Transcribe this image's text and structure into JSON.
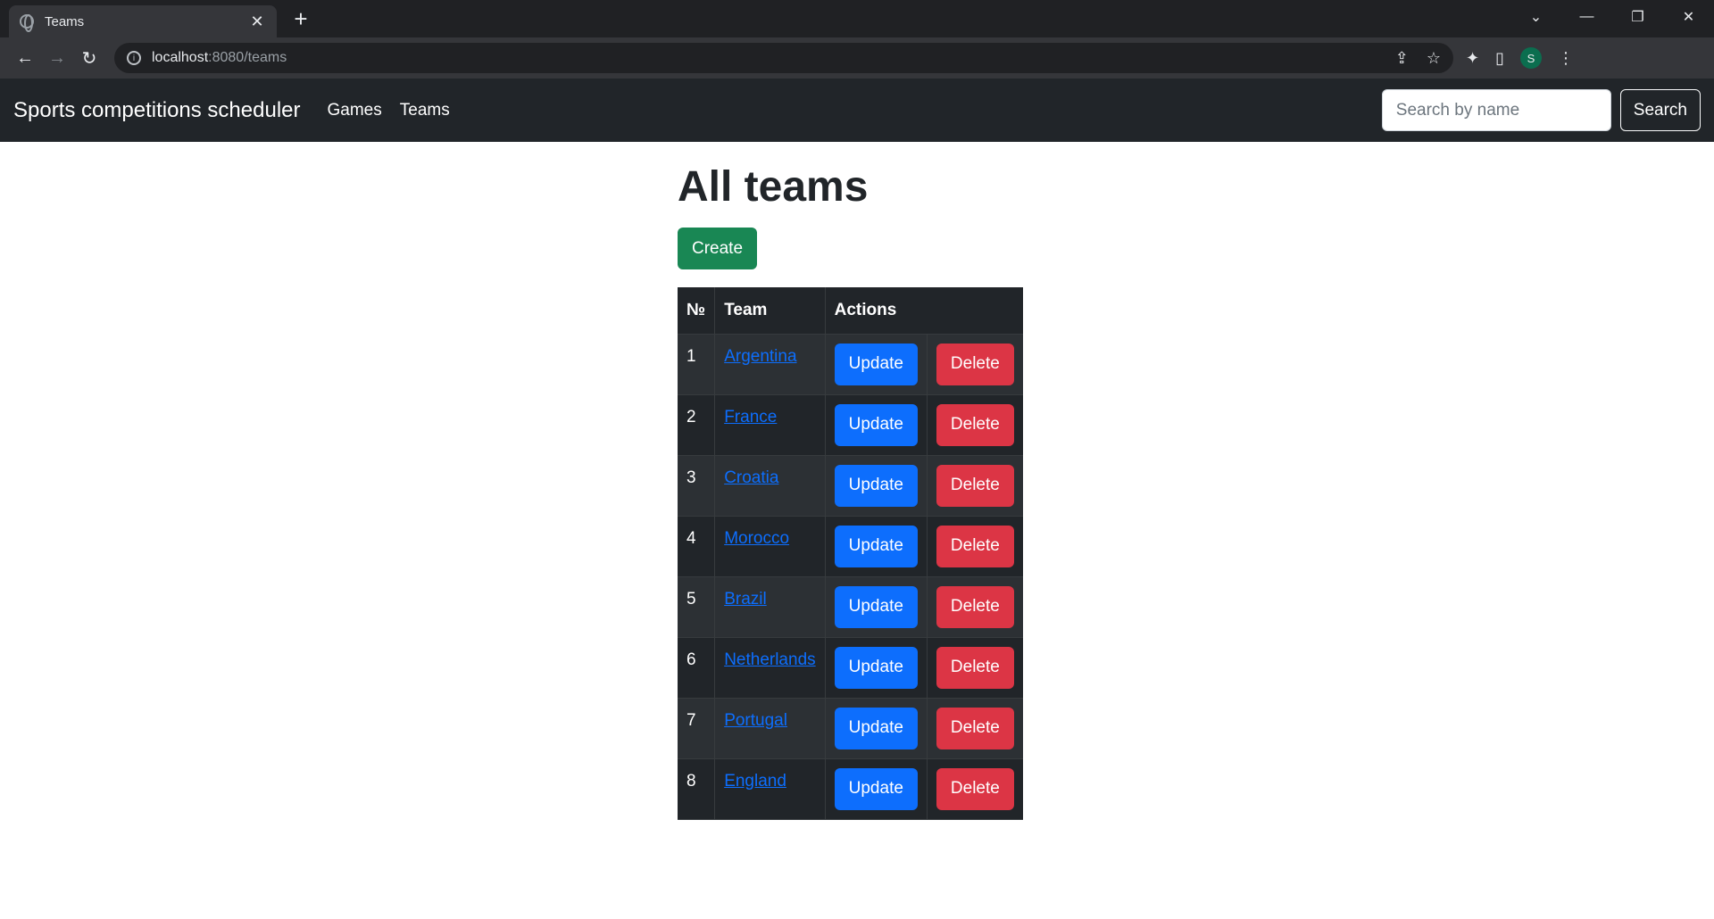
{
  "browser": {
    "tab_title": "Teams",
    "url_host": "localhost",
    "url_path": ":8080/teams",
    "profile_initial": "S"
  },
  "navbar": {
    "brand": "Sports competitions scheduler",
    "links": [
      "Games",
      "Teams"
    ],
    "search_placeholder": "Search by name",
    "search_button": "Search"
  },
  "main": {
    "title": "All teams",
    "create_button": "Create",
    "table": {
      "headers": [
        "№",
        "Team",
        "Actions"
      ],
      "update_label": "Update",
      "delete_label": "Delete",
      "rows": [
        {
          "num": "1",
          "team": "Argentina"
        },
        {
          "num": "2",
          "team": "France"
        },
        {
          "num": "3",
          "team": "Croatia"
        },
        {
          "num": "4",
          "team": "Morocco"
        },
        {
          "num": "5",
          "team": "Brazil"
        },
        {
          "num": "6",
          "team": "Netherlands"
        },
        {
          "num": "7",
          "team": "Portugal"
        },
        {
          "num": "8",
          "team": "England"
        }
      ]
    }
  },
  "colors": {
    "navbar_bg": "#212529",
    "primary": "#0d6efd",
    "danger": "#dc3545",
    "success": "#198754"
  }
}
